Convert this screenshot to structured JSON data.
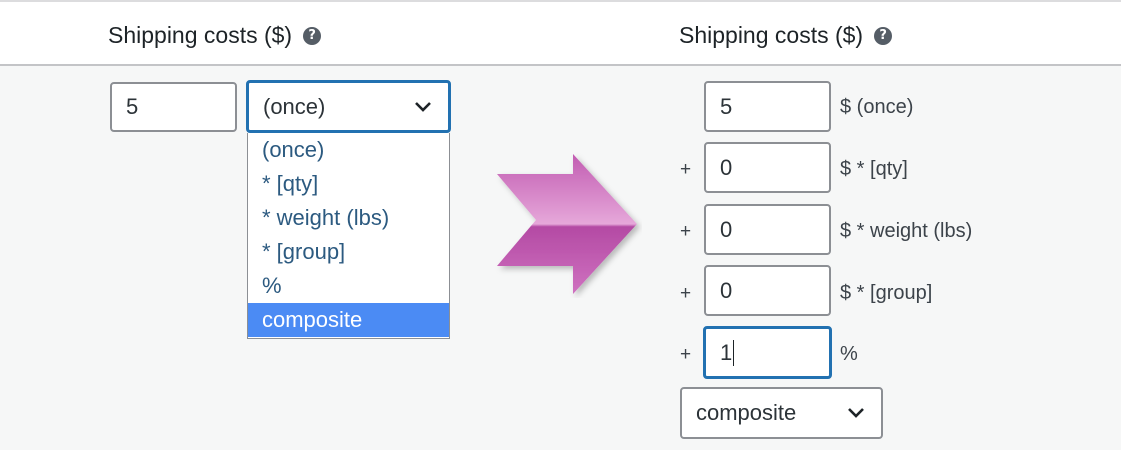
{
  "header": {
    "left_label": "Shipping costs ($)",
    "right_label": "Shipping costs ($)",
    "help_glyph": "?"
  },
  "left": {
    "cost_value": "5",
    "select_value": "(once)",
    "options": [
      "(once)",
      "* [qty]",
      "* weight (lbs)",
      "* [group]",
      "%",
      "composite"
    ],
    "highlighted_option": "composite"
  },
  "right": {
    "rows": [
      {
        "prefix": "",
        "value": "5",
        "unit": "$ (once)"
      },
      {
        "prefix": "+",
        "value": "0",
        "unit": "$ * [qty]"
      },
      {
        "prefix": "+",
        "value": "0",
        "unit": "$ * weight (lbs)"
      },
      {
        "prefix": "+",
        "value": "0",
        "unit": "$ * [group]"
      },
      {
        "prefix": "+",
        "value": "1",
        "unit": "%"
      }
    ],
    "select_value": "composite"
  },
  "colors": {
    "accent": "#2271b1",
    "option_highlight": "#4b8bf4",
    "arrow": "#c565b5"
  },
  "icons": {
    "help": "question-circle-icon",
    "dropdown": "chevron-down-icon",
    "transition": "right-arrow-icon"
  }
}
